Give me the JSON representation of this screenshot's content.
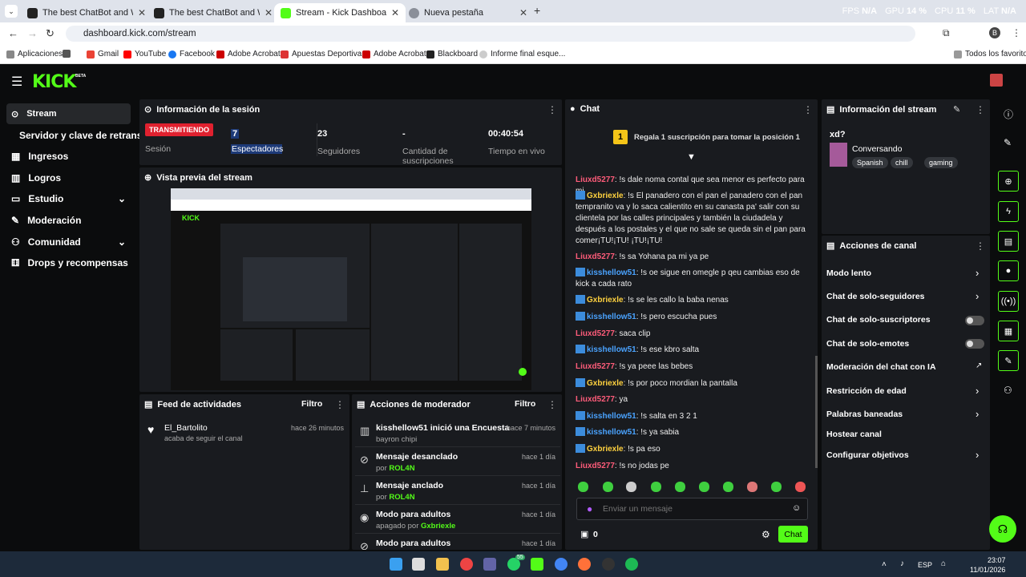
{
  "browser": {
    "tabs": [
      {
        "label": "The best ChatBot and Widgets"
      },
      {
        "label": "The best ChatBot and Widgets"
      },
      {
        "label": "Stream - Kick Dashboard"
      },
      {
        "label": "Nueva pestaña"
      }
    ],
    "url": "dashboard.kick.com/stream",
    "perf": {
      "fps_label": "FPS",
      "fps": "N/A",
      "gpu_label": "GPU",
      "gpu": "14 %",
      "cpu_label": "CPU",
      "cpu": "11 %",
      "lat_label": "LAT",
      "lat": "N/A"
    },
    "profile": "B",
    "bookmarks": [
      "Aplicaciones",
      "Gmail",
      "YouTube",
      "Facebook",
      "Adobe Acrobat",
      "Apuestas Deportiva...",
      "Adobe Acrobat",
      "Blackboard",
      "Informe final esque..."
    ],
    "all_bookmarks": "Todos los favoritos"
  },
  "kick": {
    "logo": "KICK",
    "beta": "BETA"
  },
  "sidebar": {
    "items": [
      {
        "label": "Stream"
      },
      {
        "label": "Servidor y clave de retransm"
      },
      {
        "label": "Ingresos"
      },
      {
        "label": "Logros"
      },
      {
        "label": "Estudio"
      },
      {
        "label": "Moderación"
      },
      {
        "label": "Comunidad"
      },
      {
        "label": "Drops y recompensas"
      }
    ]
  },
  "session": {
    "title": "Información de la sesión",
    "stats": [
      {
        "value": "TRANSMITIENDO",
        "label": "Sesión"
      },
      {
        "value": "7",
        "label": "Espectadores"
      },
      {
        "value": "23",
        "label": "Seguidores"
      },
      {
        "value": "-",
        "label": "Cantidad de suscripciones"
      },
      {
        "value": "00:40:54",
        "label": "Tiempo en vivo"
      }
    ]
  },
  "preview": {
    "title": "Vista previa del stream"
  },
  "feed": {
    "title": "Feed de actividades",
    "filter": "Filtro",
    "items": [
      {
        "user": "El_Bartolito",
        "action": "acaba de seguir el canal",
        "time": "hace 26 minutos"
      }
    ]
  },
  "mod_actions": {
    "title": "Acciones de moderador",
    "filter": "Filtro",
    "items": [
      {
        "title": "kisshellow51 inició una Encuesta",
        "sub": "bayron chipi",
        "time": "hace 7 minutos"
      },
      {
        "title": "Mensaje desanclado",
        "by": "por",
        "user": "ROL4N",
        "time": "hace 1 día"
      },
      {
        "title": "Mensaje anclado",
        "by": "por",
        "user": "ROL4N",
        "time": "hace 1 día"
      },
      {
        "title": "Modo para adultos",
        "by": "apagado por",
        "user": "Gxbriexle",
        "time": "hace 1 día"
      },
      {
        "title": "Modo para adultos",
        "time": "hace 1 día"
      }
    ]
  },
  "chat": {
    "title": "Chat",
    "gift": "Regala 1 suscripción para tomar la posición 1",
    "rank": "1",
    "messages": [
      {
        "u": "Liuxd5277",
        "c": "u1",
        "t": "!s dale noma contal que sea menor es perfecto para mi"
      },
      {
        "u": "Gxbriexle",
        "c": "u3",
        "t": "!s El panadero con el pan el panadero con el pan tempranito va y lo saca calientito en su canasta pa' salir con su clientela por las calles principales y también la ciudadela y después a los postales y el que no sale se queda sin el pan para comer¡TU!¡TU! ¡TU!¡TU!"
      },
      {
        "u": "Liuxd5277",
        "c": "u1",
        "t": "!s sa Yohana pa mi ya pe"
      },
      {
        "u": "kisshellow51",
        "c": "u2",
        "t": "!s oe sigue en omegle p qeu cambias eso de kick a cada rato"
      },
      {
        "u": "Gxbriexle",
        "c": "u3",
        "t": "!s se les callo la baba nenas"
      },
      {
        "u": "kisshellow51",
        "c": "u2",
        "t": "!s pero escucha pues"
      },
      {
        "u": "Liuxd5277",
        "c": "u1",
        "t": "saca clip"
      },
      {
        "u": "kisshellow51",
        "c": "u2",
        "t": "!s ese kbro salta"
      },
      {
        "u": "Liuxd5277",
        "c": "u1",
        "t": "!s ya peee las bebes"
      },
      {
        "u": "Gxbriexle",
        "c": "u3",
        "t": "!s por poco mordian la pantalla"
      },
      {
        "u": "Liuxd5277",
        "c": "u1",
        "t": "ya"
      },
      {
        "u": "kisshellow51",
        "c": "u2",
        "t": "!s salta en 3 2 1"
      },
      {
        "u": "kisshellow51",
        "c": "u2",
        "t": "!s ya sabia"
      },
      {
        "u": "Gxbriexle",
        "c": "u3",
        "t": "!s pa eso"
      },
      {
        "u": "Liuxd5277",
        "c": "u1",
        "t": "!s no jodas pe"
      }
    ],
    "placeholder": "Enviar un mensaje",
    "points": "0",
    "send": "Chat"
  },
  "stream_info": {
    "title": "Información del stream",
    "stream_title": "xd?",
    "category": "Conversando",
    "tags": [
      "Spanish",
      "chill",
      "gaming"
    ]
  },
  "channel_actions": {
    "title": "Acciones de canal",
    "items": [
      "Modo lento",
      "Chat de solo-seguidores",
      "Chat de solo-suscriptores",
      "Chat de solo-emotes",
      "Moderación del chat con IA",
      "Restricción de edad",
      "Palabras baneadas",
      "Hostear canal",
      "Configurar objetivos"
    ]
  },
  "taskbar": {
    "lang": "ESP",
    "time": "23:07",
    "date": "11/01/2026",
    "badge": "55"
  },
  "colors": {
    "accent": "#53fc18",
    "live": "#e0212f",
    "panel": "#191b1f"
  }
}
